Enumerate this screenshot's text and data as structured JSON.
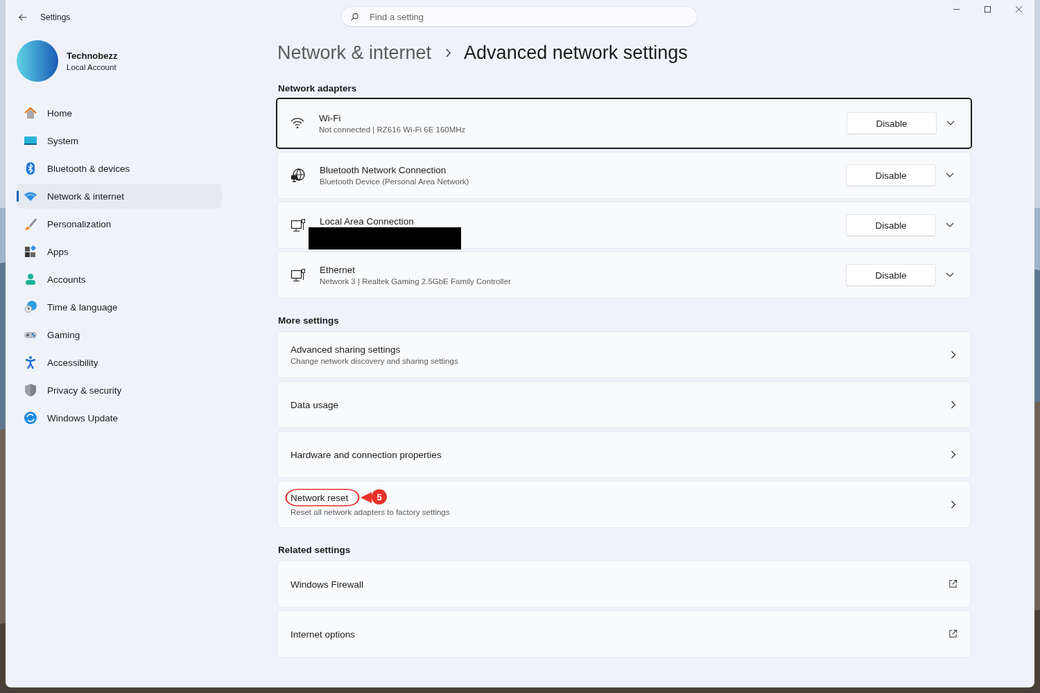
{
  "window": {
    "title": "Settings"
  },
  "search": {
    "placeholder": "Find a setting"
  },
  "account": {
    "name": "Technobezz",
    "type": "Local Account"
  },
  "sidebar": {
    "items": [
      {
        "label": "Home",
        "selected": false
      },
      {
        "label": "System",
        "selected": false
      },
      {
        "label": "Bluetooth & devices",
        "selected": false
      },
      {
        "label": "Network & internet",
        "selected": true
      },
      {
        "label": "Personalization",
        "selected": false
      },
      {
        "label": "Apps",
        "selected": false
      },
      {
        "label": "Accounts",
        "selected": false
      },
      {
        "label": "Time & language",
        "selected": false
      },
      {
        "label": "Gaming",
        "selected": false
      },
      {
        "label": "Accessibility",
        "selected": false
      },
      {
        "label": "Privacy & security",
        "selected": false
      },
      {
        "label": "Windows Update",
        "selected": false
      }
    ]
  },
  "breadcrumb": [
    "Network & internet",
    "Advanced network settings"
  ],
  "sections": [
    {
      "heading": "Network adapters",
      "items": [
        {
          "kind": "adapter",
          "title": "Wi-Fi",
          "subtitle": "Not connected | RZ616 Wi-Fi 6E 160MHz",
          "button": "Disable",
          "focused": true,
          "redacted": false
        },
        {
          "kind": "adapter",
          "title": "Bluetooth Network Connection",
          "subtitle": "Bluetooth Device (Personal Area Network)",
          "button": "Disable",
          "focused": false,
          "redacted": false
        },
        {
          "kind": "adapter",
          "title": "Local Area Connection",
          "button": "Disable",
          "focused": false,
          "redacted": true
        },
        {
          "kind": "adapter",
          "title": "Ethernet",
          "subtitle": "Network 3 | Realtek Gaming 2.5GbE Family Controller",
          "button": "Disable",
          "focused": false,
          "redacted": false
        }
      ]
    },
    {
      "heading": "More settings",
      "items": [
        {
          "kind": "link",
          "title": "Advanced sharing settings",
          "subtitle": "Change network discovery and sharing settings"
        },
        {
          "kind": "link",
          "title": "Data usage"
        },
        {
          "kind": "link",
          "title": "Hardware and connection properties"
        },
        {
          "kind": "link",
          "title": "Network reset",
          "subtitle": "Reset all network adapters to factory settings",
          "annotation": "5"
        }
      ]
    },
    {
      "heading": "Related settings",
      "items": [
        {
          "kind": "external",
          "title": "Windows Firewall"
        },
        {
          "kind": "external",
          "title": "Internet options"
        }
      ]
    }
  ]
}
